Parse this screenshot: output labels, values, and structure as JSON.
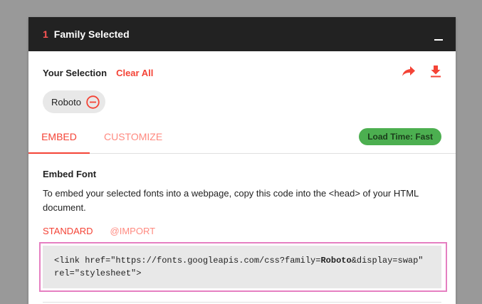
{
  "header": {
    "count": "1",
    "title": "Family Selected"
  },
  "selection": {
    "label": "Your Selection",
    "clear_label": "Clear All",
    "share_icon": "share-icon",
    "download_icon": "download-icon"
  },
  "chips": [
    {
      "label": "Roboto"
    }
  ],
  "tabs": [
    {
      "label": "EMBED",
      "active": true
    },
    {
      "label": "CUSTOMIZE",
      "active": false
    }
  ],
  "load_time": "Load Time: Fast",
  "embed": {
    "title": "Embed Font",
    "description": "To embed your selected fonts into a webpage, copy this code into the <head> of your HTML document.",
    "subtabs": [
      {
        "label": "STANDARD",
        "active": true
      },
      {
        "label": "@IMPORT",
        "active": false
      }
    ],
    "code": {
      "line1_pre": "<link href=\"https://fonts.googleapis.com/css?family=",
      "line1_bold": "Roboto",
      "line1_post": "&display=swap\"",
      "line2": "rel=\"stylesheet\">"
    }
  },
  "colors": {
    "accent": "#f44336",
    "header_bg": "#222222",
    "badge_green": "#4caf50",
    "highlight": "#e57fc1"
  }
}
